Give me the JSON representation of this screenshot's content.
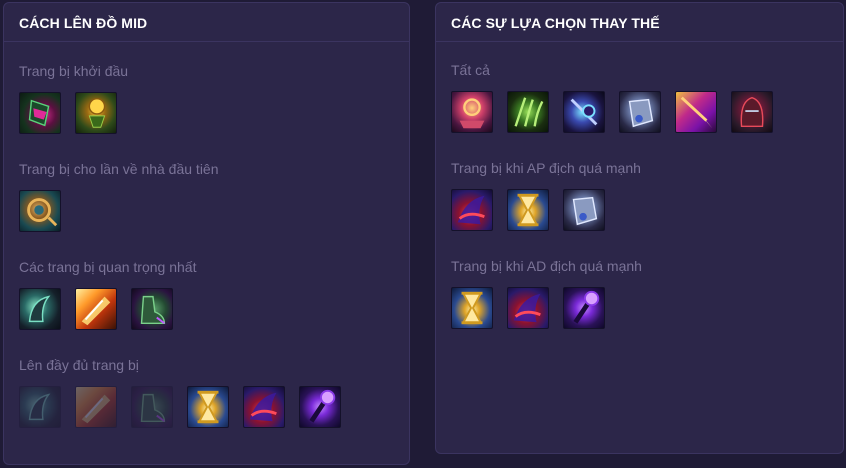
{
  "left_panel": {
    "title": "CÁCH LÊN ĐỒ MID",
    "sections": [
      {
        "label": "Trang bị khởi đầu",
        "items": [
          {
            "icon": "dark-seal-icon",
            "faded": false
          },
          {
            "icon": "corrupting-potion-icon",
            "faded": false
          }
        ]
      },
      {
        "label": "Trang bị cho lần về nhà đầu tiên",
        "items": [
          {
            "icon": "lost-chapter-icon",
            "faded": false
          }
        ]
      },
      {
        "label": "Các trang bị quan trọng nhất",
        "items": [
          {
            "icon": "luden-icon",
            "faded": false
          },
          {
            "icon": "storm-surge-icon",
            "faded": false
          },
          {
            "icon": "sorcerers-shoes-icon",
            "faded": false
          }
        ]
      },
      {
        "label": "Lên đầy đủ trang bị",
        "items": [
          {
            "icon": "luden-icon",
            "faded": true
          },
          {
            "icon": "storm-surge-icon",
            "faded": true
          },
          {
            "icon": "sorcerers-shoes-icon",
            "faded": true
          },
          {
            "icon": "zhonyas-hourglass-icon",
            "faded": false
          },
          {
            "icon": "banshees-veil-icon",
            "faded": false
          },
          {
            "icon": "void-staff-icon",
            "faded": false
          }
        ]
      }
    ]
  },
  "right_panel": {
    "title": "CÁC SỰ LỰA CHỌN THAY THẾ",
    "sections": [
      {
        "label": "Tất cả",
        "items": [
          {
            "icon": "mejais-soulstealer-icon",
            "faded": false
          },
          {
            "icon": "thornmail-icon",
            "faded": false
          },
          {
            "icon": "void-glaive-icon",
            "faded": false
          },
          {
            "icon": "armguard-icon",
            "faded": false
          },
          {
            "icon": "spear-icon",
            "faded": false
          },
          {
            "icon": "cowl-icon",
            "faded": false
          }
        ]
      },
      {
        "label": "Trang bị khi AP địch quá mạnh",
        "items": [
          {
            "icon": "banshees-veil-icon",
            "faded": false
          },
          {
            "icon": "zhonyas-hourglass-icon",
            "faded": false
          },
          {
            "icon": "armguard-icon",
            "faded": false
          }
        ]
      },
      {
        "label": "Trang bị khi AD địch quá mạnh",
        "items": [
          {
            "icon": "zhonyas-hourglass-icon",
            "faded": false
          },
          {
            "icon": "banshees-veil-icon",
            "faded": false
          },
          {
            "icon": "void-staff-icon",
            "faded": false
          }
        ]
      }
    ]
  },
  "colors": {
    "background": "#1f1b36",
    "panel": "#2c2649",
    "border": "#3b3460",
    "title": "#ffffff",
    "label": "#7a7397"
  }
}
